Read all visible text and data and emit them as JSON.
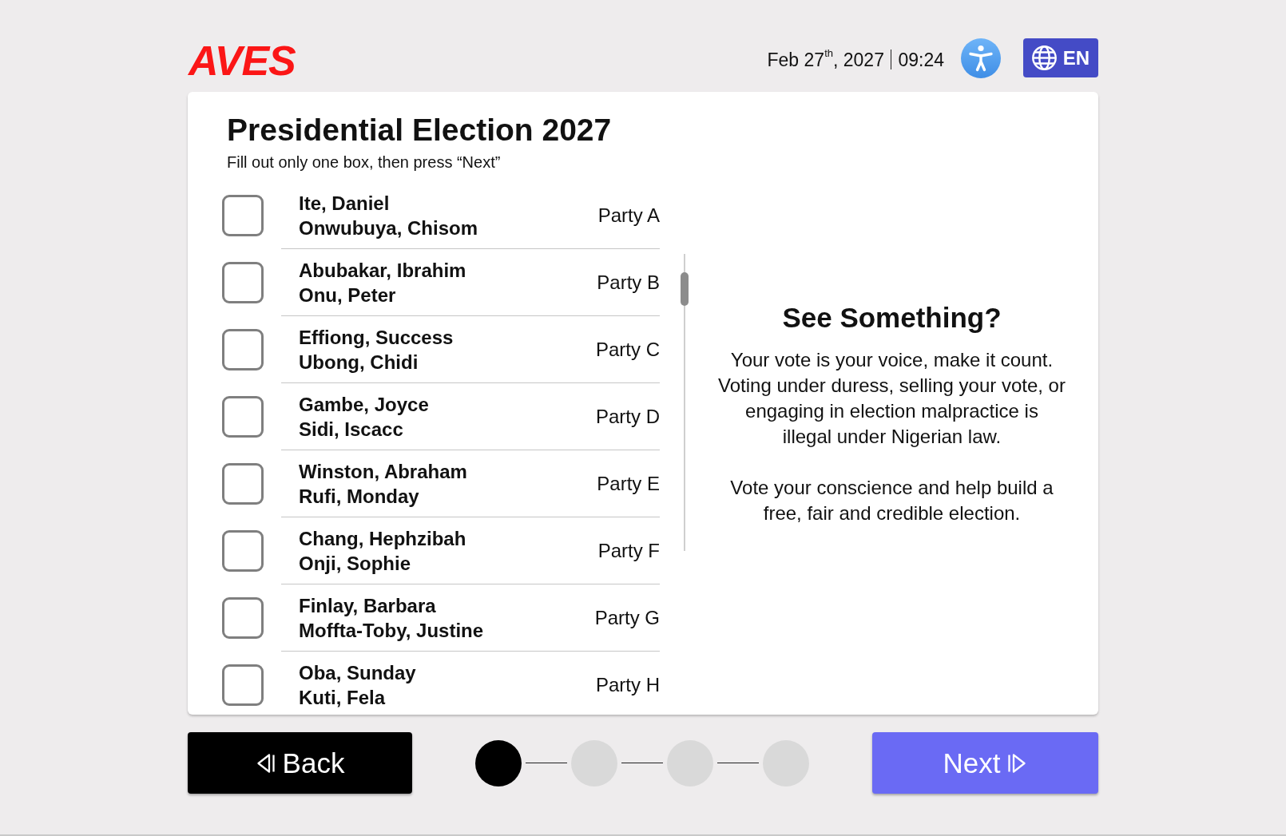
{
  "header": {
    "logo": "AVES",
    "date": "Feb 27$^{th}$, 2027",
    "time": "09:24",
    "language": "EN"
  },
  "ballot": {
    "title": "Presidential Election 2027",
    "instruction": "Fill out only one box, then press “Next”",
    "candidates": [
      {
        "names": [
          "Ite, Daniel",
          "Onwubuya, Chisom"
        ],
        "party": "Party A",
        "checked": false
      },
      {
        "names": [
          "Abubakar, Ibrahim",
          "Onu, Peter"
        ],
        "party": "Party B",
        "checked": false
      },
      {
        "names": [
          "Effiong, Success",
          "Ubong, Chidi"
        ],
        "party": "Party C",
        "checked": false
      },
      {
        "names": [
          "Gambe, Joyce",
          "Sidi, Iscacc"
        ],
        "party": "Party D",
        "checked": false
      },
      {
        "names": [
          "Winston, Abraham",
          "Rufi, Monday"
        ],
        "party": "Party E",
        "checked": false
      },
      {
        "names": [
          "Chang, Hephzibah",
          "Onji, Sophie"
        ],
        "party": "Party F",
        "checked": false
      },
      {
        "names": [
          "Finlay, Barbara",
          "Moffta-Toby, Justine"
        ],
        "party": "Party G",
        "checked": false
      },
      {
        "names": [
          "Oba, Sunday",
          "Kuti, Fela"
        ],
        "party": "Party H",
        "checked": false
      }
    ]
  },
  "notice": {
    "heading": "See Something?",
    "paragraphs": [
      "Your vote is your voice, make it count.\nVoting under duress, selling your vote, or\nengaging in election malpractice is\nillegal under Nigerian law.",
      "Vote your conscience and help build a\nfree, fair and credible election."
    ]
  },
  "footer": {
    "back": "Back",
    "steps": [
      {
        "current": true
      },
      {
        "current": false
      },
      {
        "current": false
      },
      {
        "current": false
      }
    ],
    "next": "Next"
  }
}
